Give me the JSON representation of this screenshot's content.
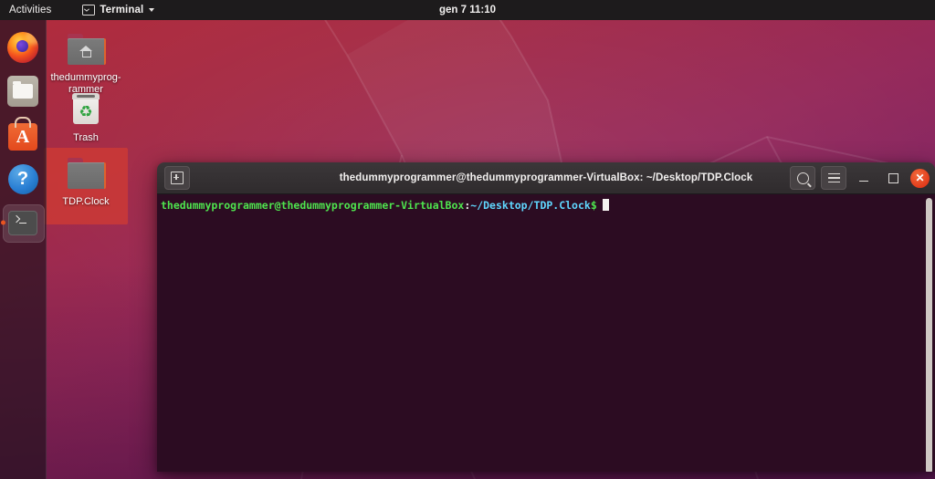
{
  "topbar": {
    "activities_label": "Activities",
    "app_menu_label": "Terminal",
    "app_menu_icon": "terminal-icon",
    "app_menu_caret_icon": "chevron-down-icon",
    "clock": "gen 7  11:10"
  },
  "dock": {
    "items": [
      {
        "name": "firefox",
        "label": "Firefox",
        "icon": "firefox-icon",
        "active": false
      },
      {
        "name": "files",
        "label": "Files",
        "icon": "files-folder-icon",
        "active": false
      },
      {
        "name": "software",
        "label": "Ubuntu Software",
        "icon": "ubuntu-software-icon",
        "glyph": "A",
        "active": false
      },
      {
        "name": "help",
        "label": "Help",
        "icon": "help-question-icon",
        "glyph": "?",
        "active": false
      },
      {
        "name": "terminal",
        "label": "Terminal",
        "icon": "terminal-app-icon",
        "active": true
      }
    ]
  },
  "desktop": {
    "icons": [
      {
        "name": "home-folder",
        "label": "thedummyprog-rammer",
        "icon": "home-folder-icon",
        "selected": false
      },
      {
        "name": "trash",
        "label": "Trash",
        "icon": "trash-icon",
        "selected": false
      },
      {
        "name": "tdp-clock-folder",
        "label": "TDP.Clock",
        "icon": "folder-icon",
        "selected": true
      }
    ]
  },
  "terminal": {
    "title": "thedummyprogrammer@thedummyprogrammer-VirtualBox: ~/Desktop/TDP.Clock",
    "new_tab_icon": "new-tab-plus-icon",
    "search_icon": "search-icon",
    "menu_icon": "hamburger-menu-icon",
    "minimize_icon": "minimize-icon",
    "maximize_icon": "maximize-icon",
    "close_icon": "close-icon",
    "close_glyph": "✕",
    "prompt": {
      "user_host": "thedummyprogrammer@thedummyprogrammer-VirtualBox",
      "colon": ":",
      "path": "~/Desktop/TDP.Clock",
      "dollar": "$",
      "command": ""
    }
  },
  "colors": {
    "accent_orange": "#e95420",
    "topbar_bg": "#1d1b1c",
    "terminal_bg": "#2c0c22",
    "prompt_green": "#4ee44e",
    "prompt_blue": "#5fd7ff",
    "selection_red": "#d23c32"
  }
}
